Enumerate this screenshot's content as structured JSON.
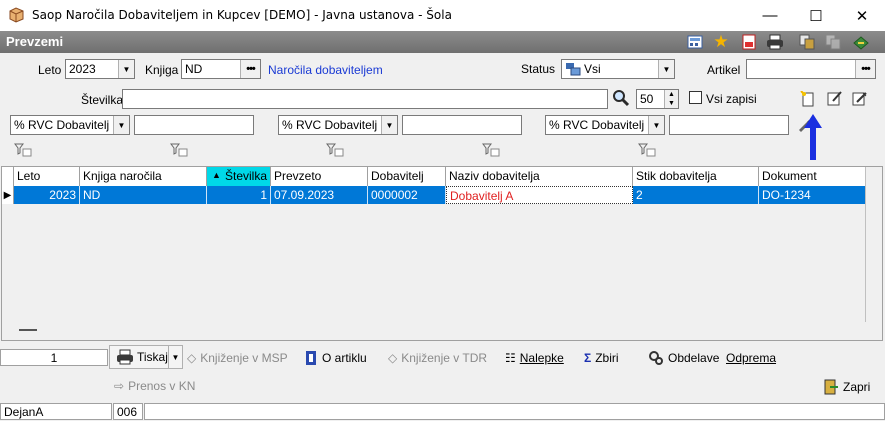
{
  "window": {
    "title": "Saop  Naročila Dobaviteljem in Kupcev [DEMO] - Javna ustanova - Šola",
    "minimize": "—",
    "maximize": "☐",
    "close": "✕"
  },
  "header": {
    "caption": "Prevzemi"
  },
  "filters": {
    "leto_label": "Leto",
    "leto_value": "2023",
    "knjiga_label": "Knjiga",
    "knjiga_value": "ND",
    "knjiga_link": "Naročila dobaviteljem",
    "status_label": "Status",
    "status_value": "Vsi",
    "artikel_label": "Artikel",
    "artikel_value": "",
    "stevilka_label": "Številka",
    "stevilka_value": "",
    "page_size": "50",
    "vsi_zapisi_label": "Vsi zapisi",
    "rvc_label_1": "% RVC Dobavitelj",
    "rvc_label_2": "% RVC Dobavitelj",
    "rvc_label_3": "% RVC Dobavitelj"
  },
  "grid": {
    "columns": [
      "Leto",
      "Knjiga naročila",
      "Številka",
      "Prevzeto",
      "Dobavitelj",
      "Naziv dobavitelja",
      "Stik dobavitelja",
      "Dokument"
    ],
    "rows": [
      {
        "leto": "2023",
        "knjiga": "ND",
        "stevilka": "1",
        "prevzeto": "07.09.2023",
        "dobavitelj": "0000002",
        "naziv": "Dobavitelj A",
        "stik": "2",
        "dokument": "DO-1234"
      }
    ],
    "sort_indicator": "▲"
  },
  "bottom": {
    "record_count": "1",
    "tiskaj": "Tiskaj",
    "knjizenje_msp": "Knjiženje v MSP",
    "o_artiklu": "O artiklu",
    "knjizenje_tdr": "Knjiženje v TDR",
    "nalepke": "Nalepke",
    "zbiri": "Zbiri",
    "obdelave": "Obdelave",
    "odprema": "Odprema",
    "prenos_kn": "Prenos v KN",
    "zapri": "Zapri"
  },
  "statusbar": {
    "user": "DejanA",
    "code": "006"
  },
  "colors": {
    "selected_row": "#0078d7",
    "link": "#1a3ad4",
    "header": "#7a7a7a",
    "arrow": "#1a2fe0"
  }
}
